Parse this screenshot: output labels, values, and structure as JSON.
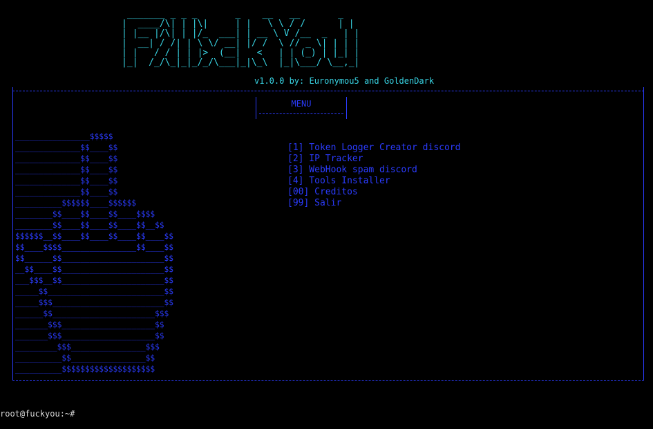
{
  "banner": {
    "ascii_art": " _______ _ _ _       _    __   __       _\n|  ____/\\| | |\\|     | |   \\ \\ / /      | |\n| |__ |/\\| | |/_  ___| | __ \\ V /__  _   | |\n|  __| / /| | \\ \\/ __| |/ /  \\ // _ \\| | | |\n| |   / / | | |>  (__|   <   | | (_) | |_| |\n|_|  /_/\\_|_|_/_/\\___|_|\\_\\  |_|\\___/ \\__,_|",
    "version_line": "v1.0.0 by: Euronymou5 and GoldenDark"
  },
  "menu": {
    "title": "MENU",
    "items": [
      "[1] Token Logger Creator discord",
      "[2] IP Tracker",
      "[3] WebHook spam discord",
      "[4] Tools Installer",
      "[00] Creditos",
      "[99] Salir"
    ]
  },
  "art": {
    "ascii": "________________$$$$$\n______________$$____$$\n______________$$____$$\n______________$$____$$\n______________$$____$$\n______________$$____$$\n__________$$$$$$____$$$$$$\n________$$____$$____$$____$$$$\n________$$____$$____$$____$$__$$\n$$$$$$__$$____$$____$$____$$____$$\n$$____$$$$________________$$____$$\n$$______$$______________________$$\n__$$____$$______________________$$\n___$$$__$$______________________$$\n_____$$_________________________$$\n_____$$$________________________$$\n______$$______________________$$$\n_______$$$____________________$$\n_______$$$____________________$$\n_________$$$________________$$$\n__________$$________________$$\n__________$$$$$$$$$$$$$$$$$$$$"
  },
  "terminal": {
    "prompt": "root@fuckyou:~#"
  },
  "colors": {
    "background": "#000000",
    "cyan": "#39d6e6",
    "blue": "#2b3cff",
    "prompt": "#d8d8d8"
  }
}
